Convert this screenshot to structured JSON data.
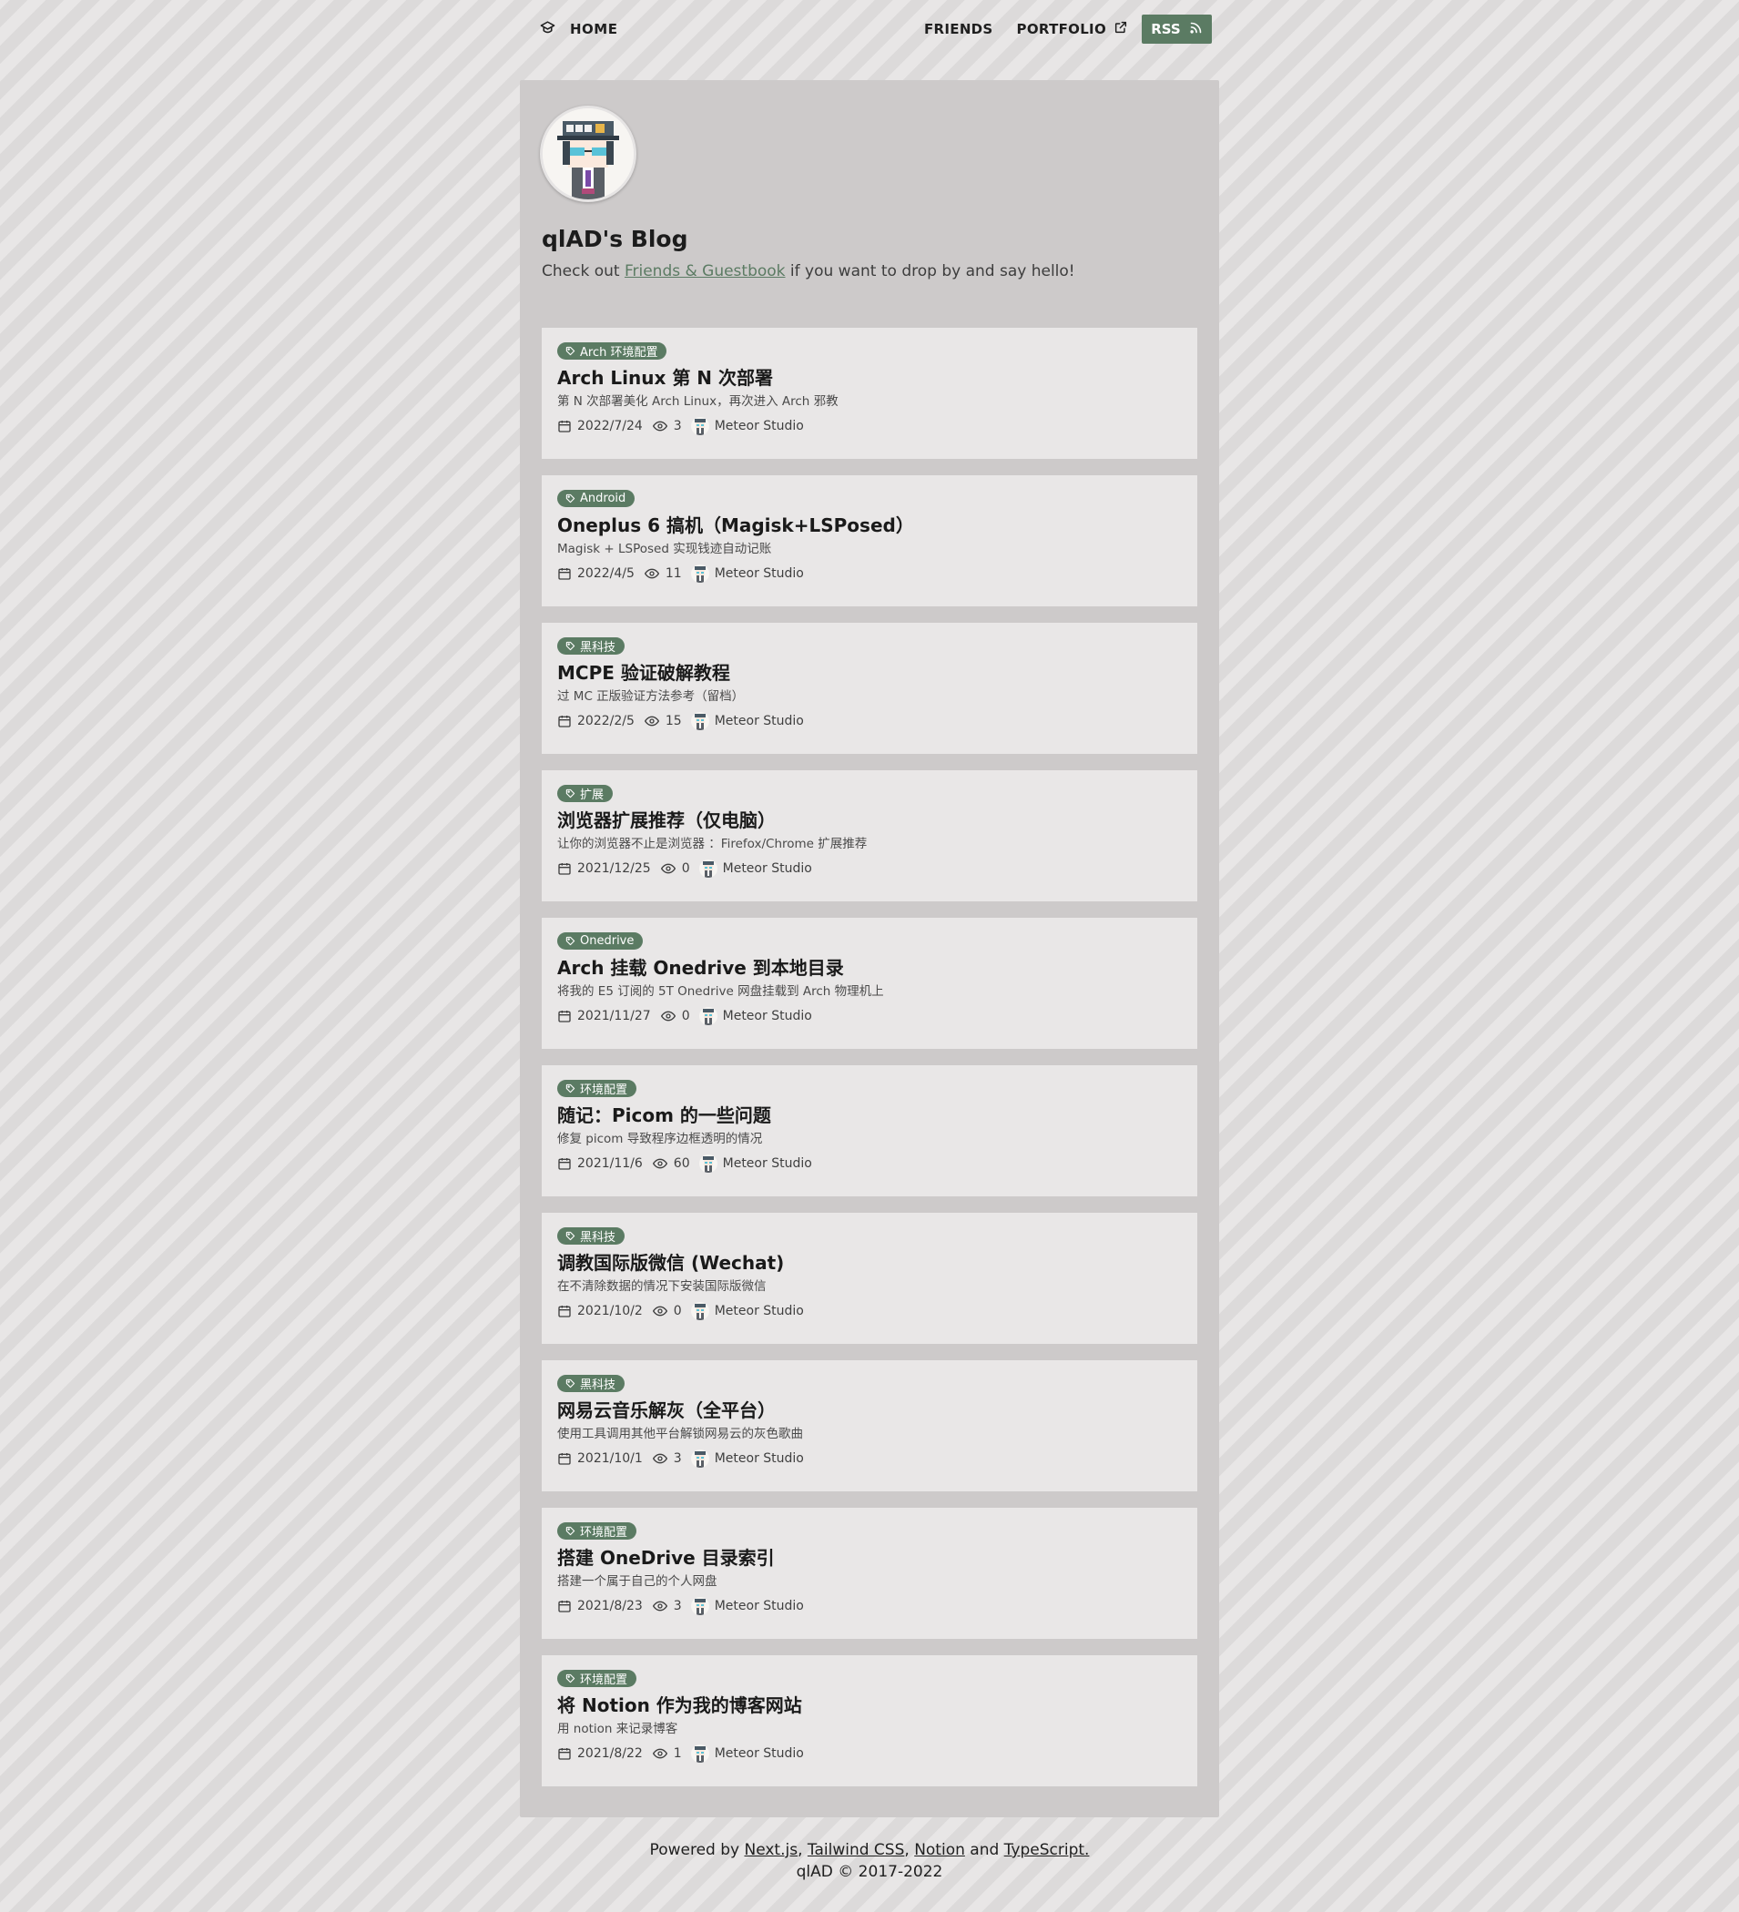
{
  "nav": {
    "home_label": "HOME",
    "friends_label": "FRIENDS",
    "portfolio_label": "PORTFOLIO",
    "rss_label": "RSS"
  },
  "blog": {
    "title": "qlAD's Blog",
    "subtitle_prefix": "Check out ",
    "subtitle_link": "Friends & Guestbook",
    "subtitle_suffix": " if you want to drop by and say hello!"
  },
  "posts": [
    {
      "tag": "Arch 环境配置",
      "title": "Arch Linux 第 N 次部署",
      "desc": "第 N 次部署美化 Arch Linux，再次进入 Arch 邪教",
      "date": "2022/7/24",
      "views": "3",
      "author": "Meteor Studio"
    },
    {
      "tag": "Android",
      "title": "Oneplus 6 搞机（Magisk+LSPosed）",
      "desc": "Magisk + LSPosed 实现钱迹自动记账",
      "date": "2022/4/5",
      "views": "11",
      "author": "Meteor Studio"
    },
    {
      "tag": "黑科技",
      "title": "MCPE 验证破解教程",
      "desc": "过 MC 正版验证方法参考（留档）",
      "date": "2022/2/5",
      "views": "15",
      "author": "Meteor Studio"
    },
    {
      "tag": "扩展",
      "title": "浏览器扩展推荐（仅电脑）",
      "desc": "让你的浏览器不止是浏览器 ：Firefox/Chrome 扩展推荐",
      "date": "2021/12/25",
      "views": "0",
      "author": "Meteor Studio"
    },
    {
      "tag": "Onedrive",
      "title": "Arch 挂载 Onedrive 到本地目录",
      "desc": "将我的 E5 订阅的 5T Onedrive 网盘挂载到 Arch 物理机上",
      "date": "2021/11/27",
      "views": "0",
      "author": "Meteor Studio"
    },
    {
      "tag": "环境配置",
      "title": "随记：Picom 的一些问题",
      "desc": "修复 picom 导致程序边框透明的情况",
      "date": "2021/11/6",
      "views": "60",
      "author": "Meteor Studio"
    },
    {
      "tag": "黑科技",
      "title": "调教国际版微信 (Wechat)",
      "desc": "在不清除数据的情况下安装国际版微信",
      "date": "2021/10/2",
      "views": "0",
      "author": "Meteor Studio"
    },
    {
      "tag": "黑科技",
      "title": "网易云音乐解灰（全平台）",
      "desc": "使用工具调用其他平台解锁网易云的灰色歌曲",
      "date": "2021/10/1",
      "views": "3",
      "author": "Meteor Studio"
    },
    {
      "tag": "环境配置",
      "title": "搭建 OneDrive 目录索引",
      "desc": "搭建一个属于自己的个人网盘",
      "date": "2021/8/23",
      "views": "3",
      "author": "Meteor Studio"
    },
    {
      "tag": "环境配置",
      "title": "将 Notion 作为我的博客网站",
      "desc": "用 notion 来记录博客",
      "date": "2021/8/22",
      "views": "1",
      "author": "Meteor Studio"
    }
  ],
  "footer": {
    "powered_by": "Powered by ",
    "link_nextjs": "Next.js",
    "sep1": ", ",
    "link_tailwind": "Tailwind CSS",
    "sep2": ", ",
    "link_notion": "Notion",
    "and": " and ",
    "link_typescript": "TypeScript.",
    "copyright": "qlAD © 2017-2022"
  },
  "icons": {
    "home": "graduation-cap-icon",
    "portfolio": "external-link-icon",
    "rss": "rss-icon",
    "tag": "tag-icon",
    "date": "calendar-icon",
    "views": "eye-icon"
  },
  "colors": {
    "accent": "#5b7b63",
    "panel": "#cdcaca",
    "card": "#e9e7e7"
  }
}
